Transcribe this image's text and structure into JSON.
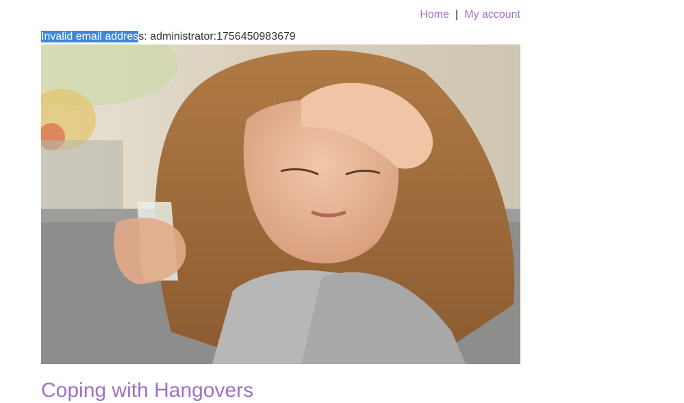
{
  "nav": {
    "home_label": "Home",
    "separator": "|",
    "account_label": "My account"
  },
  "message": {
    "selected_text": "Invalid email addres",
    "rest_text": "s: administrator:1756450983679"
  },
  "hero": {
    "alt": "Woman with headache holding a glass of water"
  },
  "post": {
    "title": "Coping with Hangovers"
  },
  "colors": {
    "link": "#a070c8",
    "selection": "#3e86de"
  }
}
